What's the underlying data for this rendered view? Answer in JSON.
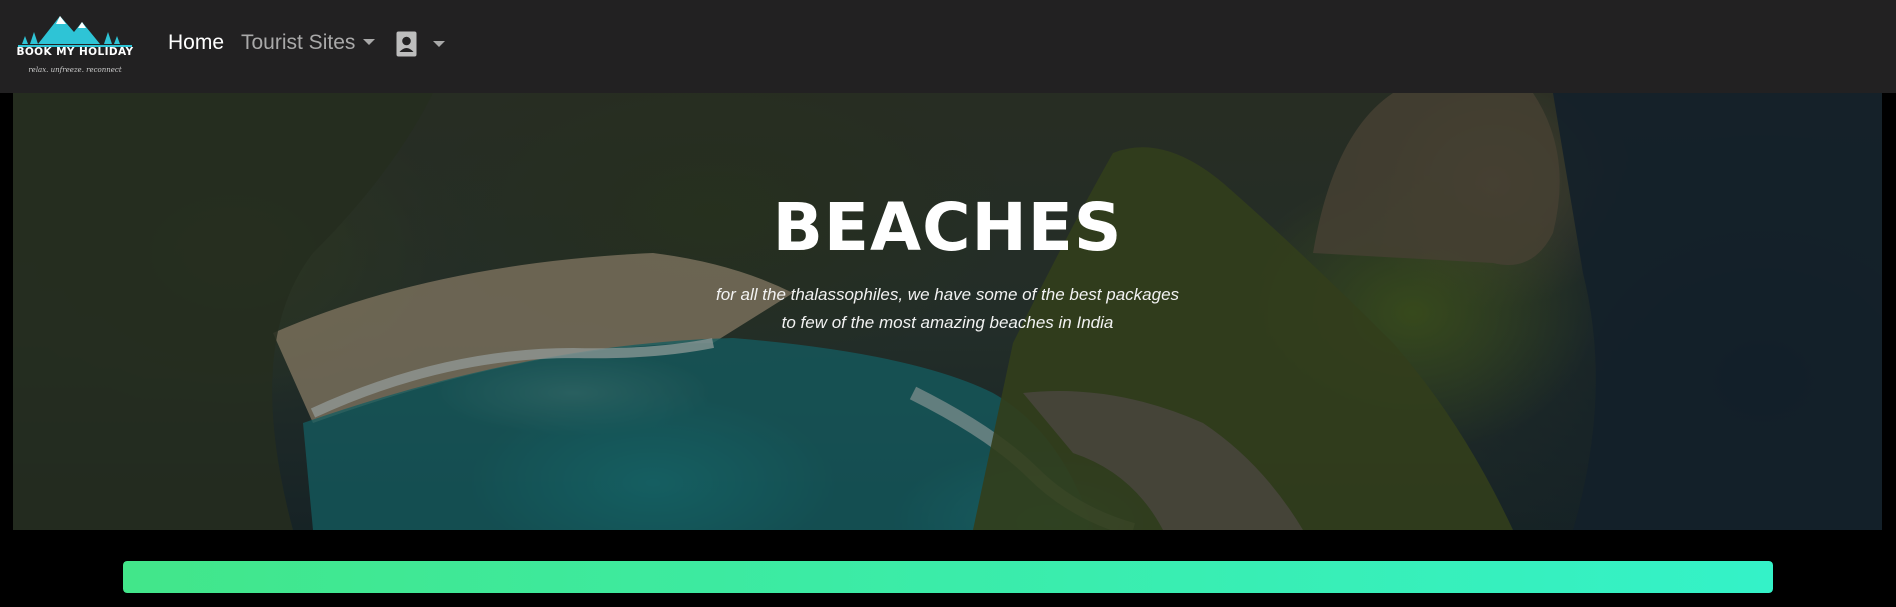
{
  "brand": {
    "name": "BOOK MY HOLIDAY",
    "tagline": "relax. unfreeze. reconnect"
  },
  "nav": {
    "home_label": "Home",
    "tourist_sites_label": "Tourist Sites",
    "user_icon": "user-portrait-icon"
  },
  "hero": {
    "title": "BEACHES",
    "subtitle_line1": "for all the thalassophiles, we have some of the best packages",
    "subtitle_line2": "to few of the most amazing beaches in India"
  },
  "progress": {
    "percent": 100,
    "color_start": "#42e68a",
    "color_end": "#34f2c8"
  },
  "colors": {
    "navbar_bg": "#222122",
    "page_bg": "#000000",
    "logo_accent": "#2ec4d6"
  }
}
